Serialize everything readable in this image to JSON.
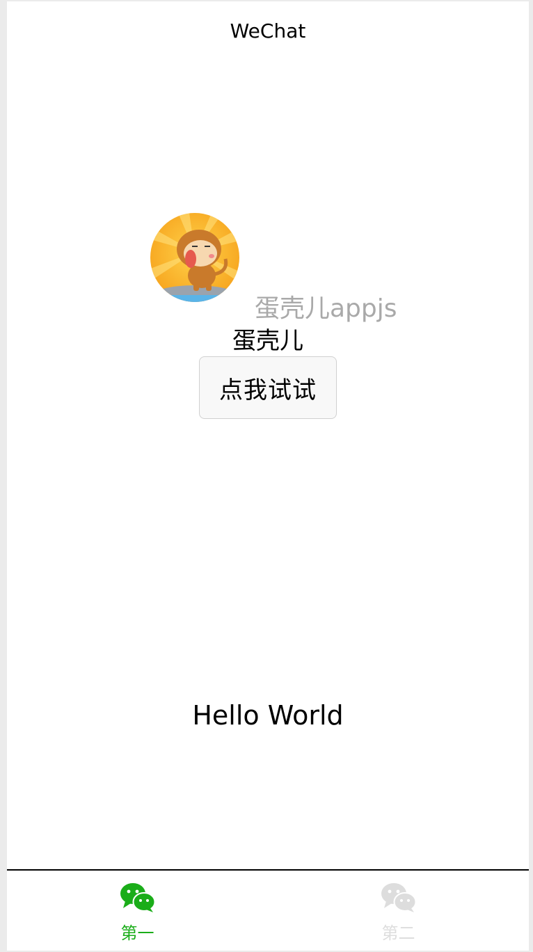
{
  "header": {
    "title": "WeChat"
  },
  "profile": {
    "nickname": "蛋壳儿",
    "watermark": "蛋壳儿appjs"
  },
  "actions": {
    "try_button_label": "点我试试"
  },
  "main": {
    "hello_text": "Hello World"
  },
  "tabbar": {
    "tabs": [
      {
        "label": "第一",
        "active": true,
        "color": "#1aad19",
        "icon": "wechat-icon"
      },
      {
        "label": "第二",
        "active": false,
        "color": "#dddddd",
        "icon": "wechat-icon"
      }
    ]
  }
}
